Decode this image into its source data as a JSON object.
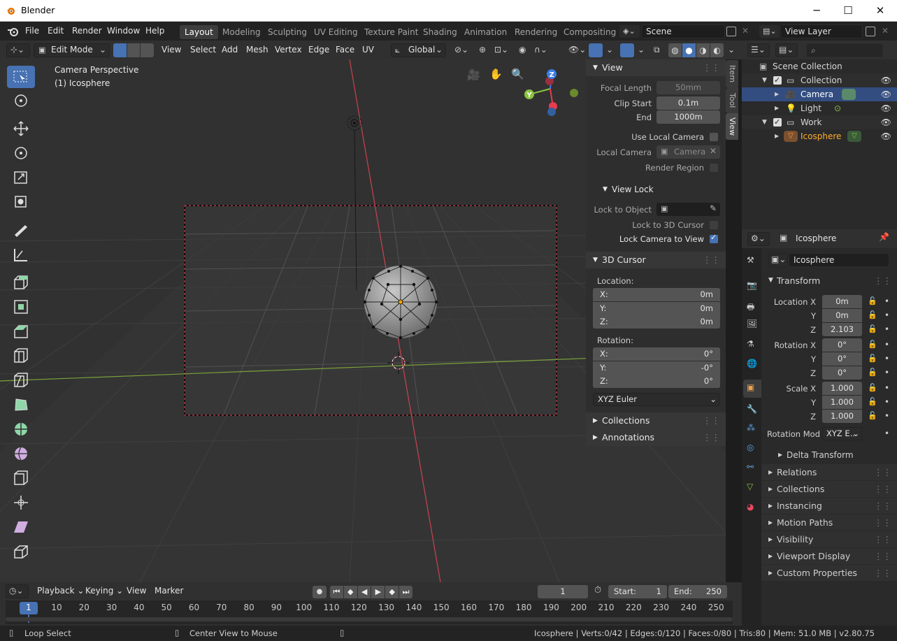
{
  "window": {
    "title": "Blender",
    "minimize": "─",
    "maximize": "☐",
    "close": "✕"
  },
  "menubar": {
    "menus": [
      "File",
      "Edit",
      "Render",
      "Window",
      "Help"
    ],
    "workspaces": [
      "Layout",
      "Modeling",
      "Sculpting",
      "UV Editing",
      "Texture Paint",
      "Shading",
      "Animation",
      "Rendering",
      "Compositing"
    ],
    "scene": "Scene",
    "view_layer": "View Layer"
  },
  "header3d": {
    "mode": "Edit Mode",
    "menus": [
      "View",
      "Select",
      "Add",
      "Mesh",
      "Vertex",
      "Edge",
      "Face",
      "UV"
    ],
    "orientation": "Global"
  },
  "viewport": {
    "overlay_title": "Camera Perspective",
    "overlay_sub": "(1) Icosphere",
    "gizmo": {
      "z": "Z",
      "y": "Y"
    }
  },
  "npanel": {
    "tabs": [
      "Item",
      "Tool",
      "View"
    ],
    "view": {
      "header": "View",
      "focal_length_label": "Focal Length",
      "focal_length": "50mm",
      "clip_start_label": "Clip Start",
      "clip_start": "0.1m",
      "end_label": "End",
      "end": "1000m",
      "use_local_camera": "Use Local Camera",
      "local_camera_label": "Local Camera",
      "local_camera": "Camera",
      "render_region": "Render Region"
    },
    "view_lock": {
      "header": "View Lock",
      "lock_to_object": "Lock to Object",
      "lock_to_cursor": "Lock to 3D Cursor",
      "lock_camera": "Lock Camera to View"
    },
    "cursor": {
      "header": "3D Cursor",
      "location_label": "Location:",
      "loc": [
        {
          "axis": "X:",
          "val": "0m"
        },
        {
          "axis": "Y:",
          "val": "0m"
        },
        {
          "axis": "Z:",
          "val": "0m"
        }
      ],
      "rotation_label": "Rotation:",
      "rot": [
        {
          "axis": "X:",
          "val": "0°"
        },
        {
          "axis": "Y:",
          "val": "-0°"
        },
        {
          "axis": "Z:",
          "val": "0°"
        }
      ],
      "rotation_mode": "XYZ Euler"
    },
    "collections": "Collections",
    "annotations": "Annotations"
  },
  "outliner": {
    "items": [
      "Scene Collection",
      "Collection",
      "Camera",
      "Light",
      "Work",
      "Icosphere"
    ]
  },
  "properties": {
    "object_name": "Icosphere",
    "data_name": "Icosphere",
    "transform": "Transform",
    "location_x_label": "Location X",
    "location_x": "0m",
    "y_label": "Y",
    "location_y": "0m",
    "z_label": "Z",
    "location_z": "2.103",
    "rotation_x_label": "Rotation X",
    "rotation_x": "0°",
    "rotation_y": "0°",
    "rotation_z": "0°",
    "scale_x_label": "Scale X",
    "scale_x": "1.000",
    "scale_y": "1.000",
    "scale_z": "1.000",
    "rotation_mode_label": "Rotation Mod",
    "rotation_mode": "XYZ E..",
    "delta_transform": "Delta Transform",
    "sections": [
      "Relations",
      "Collections",
      "Instancing",
      "Motion Paths",
      "Visibility",
      "Viewport Display",
      "Custom Properties"
    ]
  },
  "timeline": {
    "menus": [
      "Playback",
      "Keying",
      "View",
      "Marker"
    ],
    "current_frame": "1",
    "start_label": "Start:",
    "start": "1",
    "end_label": "End:",
    "end": "250",
    "ticks": [
      "1",
      "10",
      "20",
      "30",
      "40",
      "50",
      "60",
      "70",
      "80",
      "90",
      "100",
      "110",
      "120",
      "130",
      "140",
      "150",
      "160",
      "170",
      "180",
      "190",
      "200",
      "210",
      "220",
      "230",
      "240",
      "250"
    ]
  },
  "statusbar": {
    "left": "Loop Select",
    "middle": "Center View to Mouse",
    "stats": "Icosphere | Verts:0/42 | Edges:0/120 | Faces:0/80 | Tris:80 | Mem: 51.0 MB | v2.80.75"
  },
  "colors": {
    "accent": "#4772b3",
    "selected_text": "#ffaf29",
    "axis_x": "#e83b50",
    "axis_y": "#8ac33f",
    "axis_z": "#3b7ee8"
  }
}
